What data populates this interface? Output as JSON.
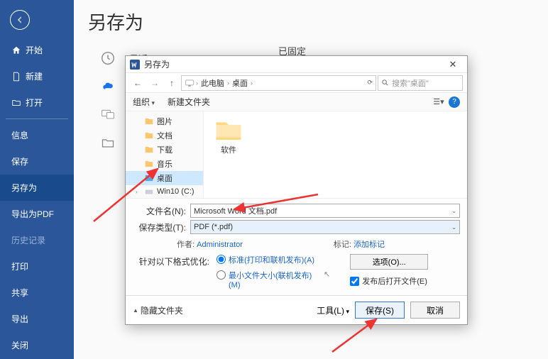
{
  "backstage": {
    "title": "另存为",
    "nav": {
      "home": "开始",
      "new": "新建",
      "open": "打开",
      "info": "信息",
      "save": "保存",
      "saveas": "另存为",
      "exportpdf": "导出为PDF",
      "history": "历史记录",
      "print": "打印",
      "share": "共享",
      "export": "导出",
      "close": "关闭"
    },
    "locations": {
      "recent": "最近",
      "pinned": "已固定"
    }
  },
  "dialog": {
    "title": "另存为",
    "breadcrumb": {
      "top": "此电脑",
      "folder": "桌面"
    },
    "search_placeholder": "搜索\"桌面\"",
    "toolbar": {
      "organize": "组织",
      "newfolder": "新建文件夹"
    },
    "tree": {
      "pictures": "图片",
      "documents": "文档",
      "downloads": "下载",
      "music": "音乐",
      "desktop": "桌面",
      "drive": "Win10 (C:)"
    },
    "content_folder": "软件",
    "filename_label": "文件名(N):",
    "filename_value": "Microsoft Word 文档.pdf",
    "savetype_label": "保存类型(T):",
    "savetype_value": "PDF (*.pdf)",
    "author_label": "作者:",
    "author_value": "Administrator",
    "tags_label": "标记:",
    "tags_value": "添加标记",
    "optimize_label": "针对以下格式优化:",
    "optimize_std": "标准(打印和联机发布)(A)",
    "optimize_min": "最小文件大小(联机发布)(M)",
    "options_btn": "选项(O)...",
    "open_after": "发布后打开文件(E)",
    "hide_folders": "隐藏文件夹",
    "tools": "工具(L)",
    "save_btn": "保存(S)",
    "cancel_btn": "取消"
  }
}
